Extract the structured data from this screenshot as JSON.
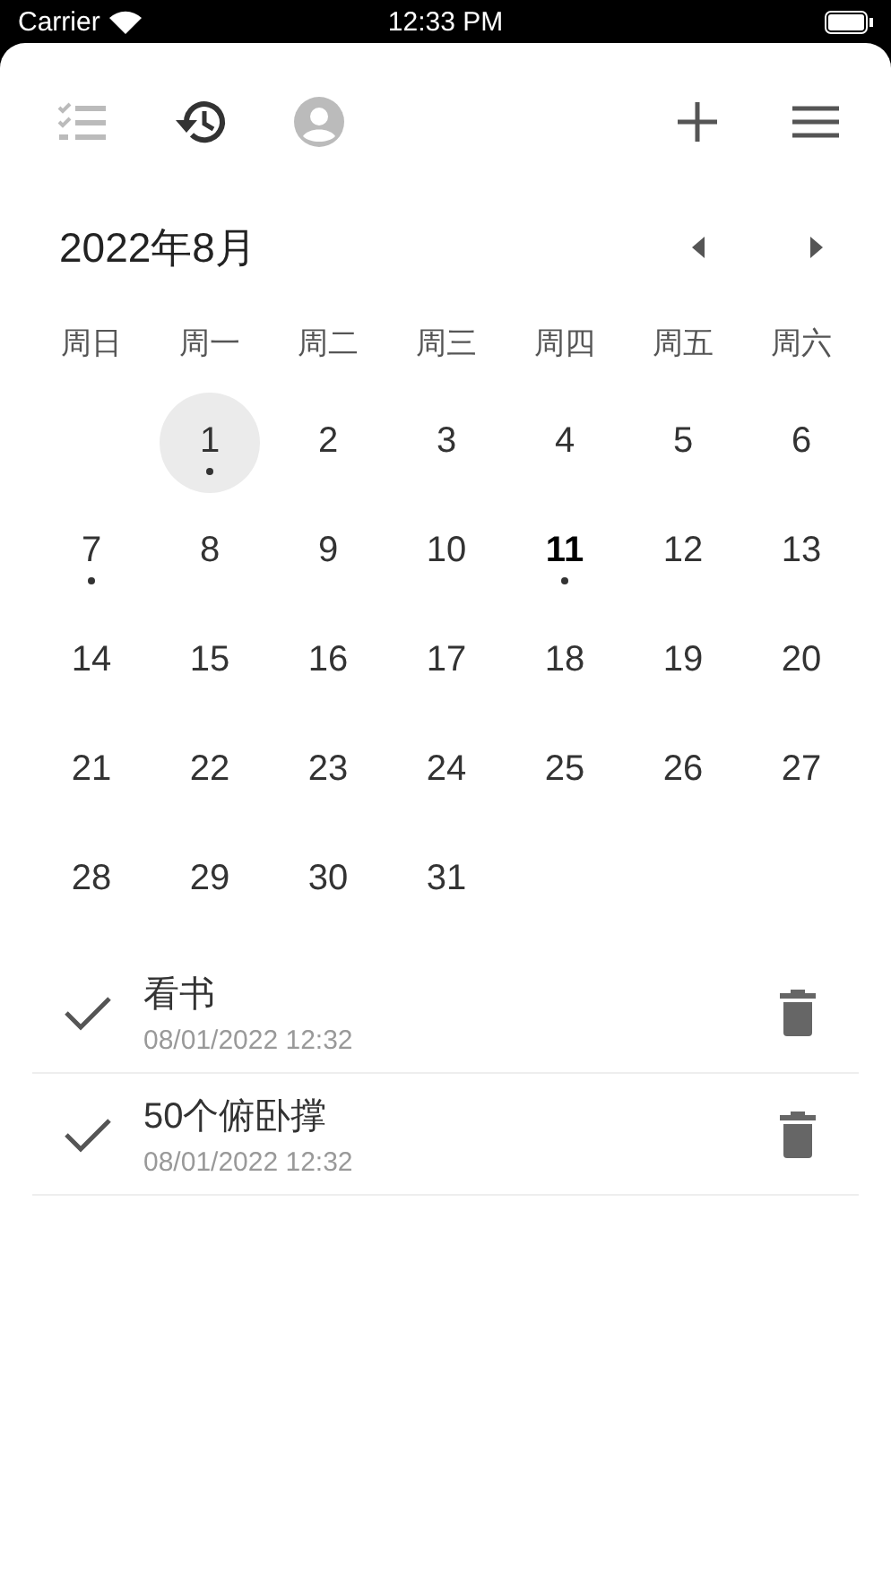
{
  "status_bar": {
    "carrier": "Carrier",
    "time": "12:33 PM"
  },
  "toolbar": {
    "views": [
      {
        "kind": "checklist",
        "selected": false
      },
      {
        "kind": "history",
        "selected": true
      },
      {
        "kind": "profile",
        "selected": false
      }
    ]
  },
  "calendar": {
    "title": "2022年8月",
    "weekdays": [
      "周日",
      "周一",
      "周二",
      "周三",
      "周四",
      "周五",
      "周六"
    ],
    "weeks": [
      [
        {
          "day": "1",
          "selected": true,
          "today": false,
          "has_event": true
        },
        {
          "day": "2",
          "selected": false,
          "today": false,
          "has_event": false
        },
        {
          "day": "3",
          "selected": false,
          "today": false,
          "has_event": false
        },
        {
          "day": "4",
          "selected": false,
          "today": false,
          "has_event": false
        },
        {
          "day": "5",
          "selected": false,
          "today": false,
          "has_event": false
        },
        {
          "day": "6",
          "selected": false,
          "today": false,
          "has_event": false
        }
      ],
      [
        {
          "day": "7",
          "selected": false,
          "today": false,
          "has_event": true
        },
        {
          "day": "8",
          "selected": false,
          "today": false,
          "has_event": false
        },
        {
          "day": "9",
          "selected": false,
          "today": false,
          "has_event": false
        },
        {
          "day": "10",
          "selected": false,
          "today": false,
          "has_event": false
        },
        {
          "day": "11",
          "selected": false,
          "today": true,
          "has_event": true
        },
        {
          "day": "12",
          "selected": false,
          "today": false,
          "has_event": false
        },
        {
          "day": "13",
          "selected": false,
          "today": false,
          "has_event": false
        }
      ],
      [
        {
          "day": "14",
          "selected": false,
          "today": false,
          "has_event": false
        },
        {
          "day": "15",
          "selected": false,
          "today": false,
          "has_event": false
        },
        {
          "day": "16",
          "selected": false,
          "today": false,
          "has_event": false
        },
        {
          "day": "17",
          "selected": false,
          "today": false,
          "has_event": false
        },
        {
          "day": "18",
          "selected": false,
          "today": false,
          "has_event": false
        },
        {
          "day": "19",
          "selected": false,
          "today": false,
          "has_event": false
        },
        {
          "day": "20",
          "selected": false,
          "today": false,
          "has_event": false
        }
      ],
      [
        {
          "day": "21",
          "selected": false,
          "today": false,
          "has_event": false
        },
        {
          "day": "22",
          "selected": false,
          "today": false,
          "has_event": false
        },
        {
          "day": "23",
          "selected": false,
          "today": false,
          "has_event": false
        },
        {
          "day": "24",
          "selected": false,
          "today": false,
          "has_event": false
        },
        {
          "day": "25",
          "selected": false,
          "today": false,
          "has_event": false
        },
        {
          "day": "26",
          "selected": false,
          "today": false,
          "has_event": false
        },
        {
          "day": "27",
          "selected": false,
          "today": false,
          "has_event": false
        }
      ],
      [
        {
          "day": "28",
          "selected": false,
          "today": false,
          "has_event": false
        },
        {
          "day": "29",
          "selected": false,
          "today": false,
          "has_event": false
        },
        {
          "day": "30",
          "selected": false,
          "today": false,
          "has_event": false
        },
        {
          "day": "31",
          "selected": false,
          "today": false,
          "has_event": false
        }
      ]
    ]
  },
  "tasks": [
    {
      "title": "看书",
      "time": "08/01/2022 12:32",
      "done": true
    },
    {
      "title": "50个俯卧撑",
      "time": "08/01/2022 12:32",
      "done": true
    }
  ]
}
